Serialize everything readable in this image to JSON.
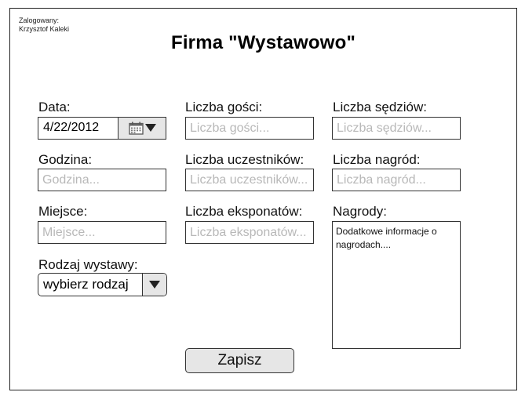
{
  "header": {
    "login_label": "Zalogowany:",
    "login_user": "Krzysztof Kaleki",
    "title": "Firma \"Wystawowo\""
  },
  "form": {
    "date": {
      "label": "Data:",
      "value": "4/22/2012"
    },
    "hour": {
      "label": "Godzina:",
      "placeholder": "Godzina..."
    },
    "place": {
      "label": "Miejsce:",
      "placeholder": "Miejsce..."
    },
    "exhibition_type": {
      "label": "Rodzaj wystawy:",
      "value": "wybierz rodzaj"
    },
    "guests": {
      "label": "Liczba gości:",
      "placeholder": "Liczba gości..."
    },
    "participants": {
      "label": "Liczba uczestników:",
      "placeholder": "Liczba uczestników..."
    },
    "exhibits": {
      "label": "Liczba eksponatów:",
      "placeholder": "Liczba eksponatów..."
    },
    "judges": {
      "label": "Liczba sędziów:",
      "placeholder": "Liczba sędziów..."
    },
    "prizes_count": {
      "label": "Liczba nagród:",
      "placeholder": "Liczba nagród..."
    },
    "prizes": {
      "label": "Nagrody:",
      "value": "Dodatkowe informacje o nagrodach...."
    },
    "save_label": "Zapisz"
  },
  "icons": {
    "calendar": "calendar-icon",
    "dropdown": "triangle-down-icon"
  }
}
